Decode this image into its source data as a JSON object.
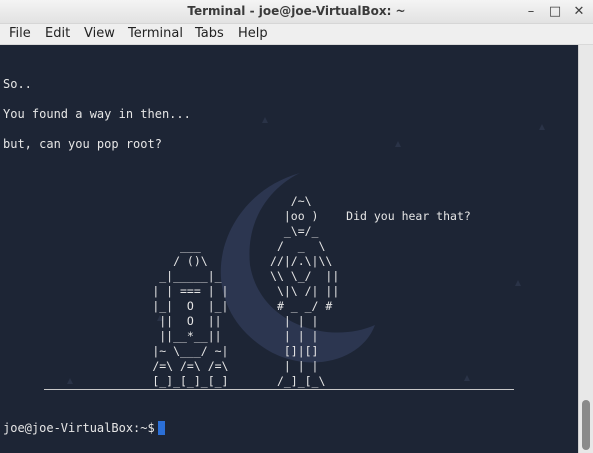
{
  "window": {
    "title": "Terminal - joe@joe-VirtualBox: ~",
    "controls": {
      "minimize": "–",
      "maximize": "□",
      "close": "✕"
    }
  },
  "menubar": {
    "items": [
      "File",
      "Edit",
      "View",
      "Terminal",
      "Tabs",
      "Help"
    ]
  },
  "terminal": {
    "lines": [
      "So..",
      "You found a way in then...",
      "but, can you pop root?"
    ],
    "art": [
      "                                          /~\\",
      "                                         |oo )    Did you hear that?",
      "                                         _\\=/_",
      "                          ___           /  _  \\",
      "                         / ()\\         //|/.\\|\\\\",
      "                       _|_____|_       \\\\ \\_/  ||",
      "                      | | === | |       \\|\\ /| ||",
      "                      |_|  O  |_|       # _ _/ #",
      "                       ||  O  ||         | | |",
      "                       ||__*__||         | | |",
      "                      |~ \\___/ ~|        []|[]",
      "                      /=\\ /=\\ /=\\        | | |",
      "                      [_]_[_]_[_]       /_]_[_\\"
    ],
    "prompt": "joe@joe-VirtualBox:~$"
  },
  "colors": {
    "terminal_bg": "#1d2535",
    "cursor": "#2b6fd6",
    "text": "#e6e6e6"
  }
}
